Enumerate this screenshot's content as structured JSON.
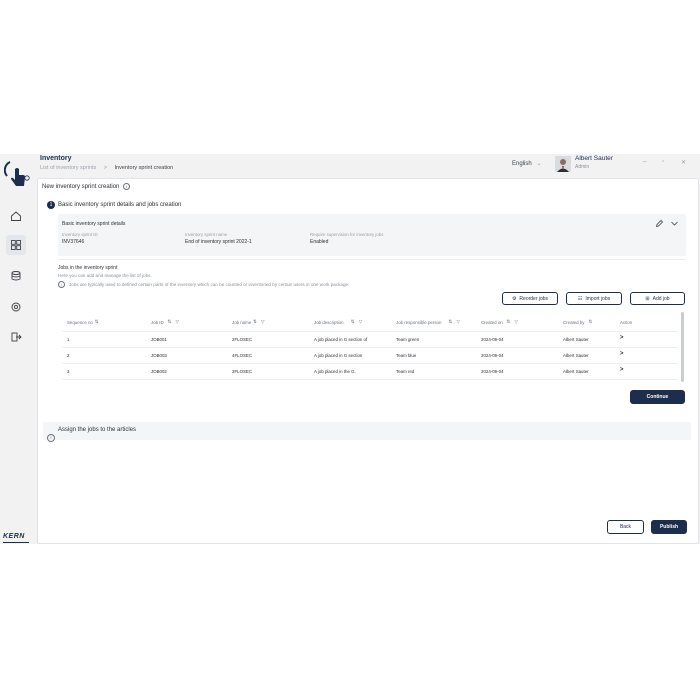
{
  "header": {
    "title": "Inventory",
    "breadcrumb_parent": "List of inventory sprints",
    "breadcrumb_separator": ">",
    "breadcrumb_current": "Inventory sprint creation",
    "language": "English",
    "user_name": "Albert Sauter",
    "user_role": "Admin"
  },
  "page": {
    "heading": "New inventory sprint creation"
  },
  "section1": {
    "number": "1",
    "title": "Basic inventory sprint details and jobs creation",
    "details_title": "Basic inventory sprint details",
    "fields": [
      {
        "label": "Inventory sprint ID",
        "value": "INV37646"
      },
      {
        "label": "Inventory sprint name",
        "value": "End of inventory sprint 2022-1"
      },
      {
        "label": "Require supervision for inventory jobs",
        "value": "Enabled"
      }
    ],
    "jobs_title": "Jobs in the inventory sprint",
    "jobs_subtitle": "Here you can add and manage the list of jobs.",
    "jobs_info": "Jobs are typically used to defined certain parts of the inventory which can be counted or inventoried by certain users in one work package.",
    "buttons": {
      "reorder": "Reorder jobs",
      "import": "Import jobs",
      "add": "Add job"
    },
    "table": {
      "columns": [
        "Sequence no",
        "Job ID",
        "Job name",
        "Job description",
        "Job responsible person",
        "Created on",
        "Created by",
        "Action"
      ],
      "rows": [
        [
          "1",
          "JOB001",
          "2FLOSEC",
          "A job placed in G section of",
          "Team green",
          "2024-09-04",
          "Albert Sauter",
          ">"
        ],
        [
          "2",
          "JOB003",
          "4FLOSEC",
          "A job placed in G section",
          "Team blue",
          "2024-09-04",
          "Albert Sauter",
          ">"
        ],
        [
          "3",
          "JOB002",
          "3FLOSEC",
          "A job placed in the G.",
          "Team red",
          "2024-09-04",
          "Albert Sauter",
          ">"
        ]
      ]
    },
    "continue_label": "Continue"
  },
  "section2": {
    "title": "Assign the jobs to the articles"
  },
  "footer": {
    "back_label": "Back",
    "publish_label": "Publish",
    "brand": "KERN"
  },
  "colors": {
    "primary": "#1c2d4d",
    "background": "#f2f2f2",
    "panel": "#ffffff"
  }
}
